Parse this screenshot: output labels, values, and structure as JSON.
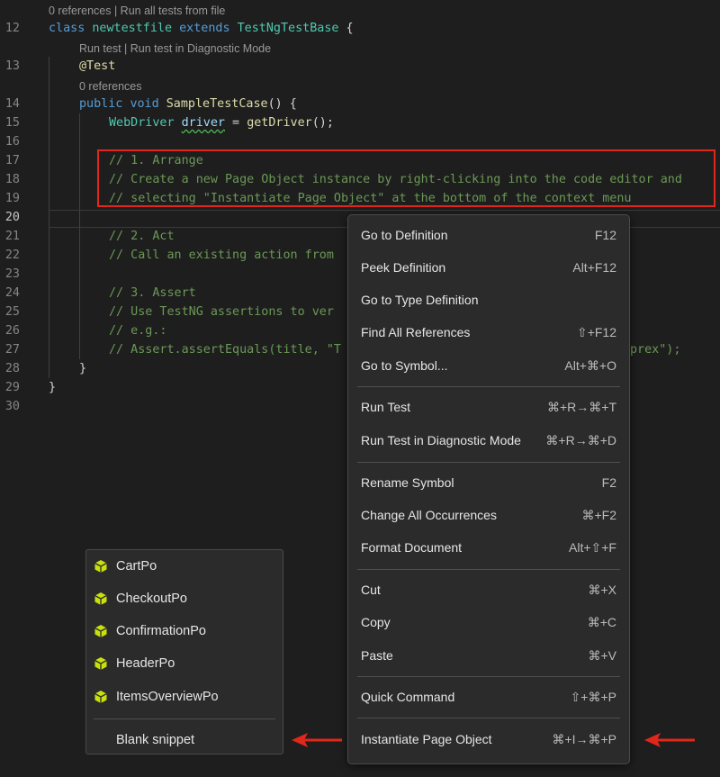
{
  "codelens": {
    "class_refs": "0 references | Run all tests from file",
    "run_test": "Run test | Run test in Diagnostic Mode",
    "method_refs": "0 references"
  },
  "lines": [
    {
      "n": "12"
    },
    {
      "n": "13"
    },
    {
      "n": "14"
    },
    {
      "n": "15"
    },
    {
      "n": "16"
    },
    {
      "n": "17"
    },
    {
      "n": "18"
    },
    {
      "n": "19"
    },
    {
      "n": "20"
    },
    {
      "n": "21"
    },
    {
      "n": "22"
    },
    {
      "n": "23"
    },
    {
      "n": "24"
    },
    {
      "n": "25"
    },
    {
      "n": "26"
    },
    {
      "n": "27"
    },
    {
      "n": "28"
    },
    {
      "n": "29"
    },
    {
      "n": "30"
    }
  ],
  "code": {
    "l12_kw_class": "class",
    "l12_name": "newtestfile",
    "l12_kw_extends": "extends",
    "l12_base": "TestNgTestBase",
    "l12_brace": " {",
    "l13": "@Test",
    "l14_kw_public": "public",
    "l14_kw_void": "void",
    "l14_fn": "SampleTestCase",
    "l14_rest": "() {",
    "l15_type": "WebDriver",
    "l15_var": "driver",
    "l15_eq": " = ",
    "l15_fn": "getDriver",
    "l15_rest": "();",
    "l17": "// 1. Arrange",
    "l18": "// Create a new Page Object instance by right-clicking into the code editor and",
    "l19": "// selecting \"Instantiate Page Object\" at the bottom of the context menu",
    "l21": "// 2. Act",
    "l22": "// Call an existing action from",
    "l24": "// 3. Assert",
    "l25": "// Use TestNG assertions to ver",
    "l26": "// e.g.:",
    "l27": "// Assert.assertEquals(title, \"T",
    "l27_tail": "prex\");",
    "l28": "}",
    "l29": "}"
  },
  "context_menu": {
    "items": [
      {
        "label": "Go to Definition",
        "key": "F12"
      },
      {
        "label": "Peek Definition",
        "key": "Alt+F12"
      },
      {
        "label": "Go to Type Definition",
        "key": ""
      },
      {
        "label": "Find All References",
        "key": "⇧+F12"
      },
      {
        "label": "Go to Symbol...",
        "key": "Alt+⌘+O"
      },
      {
        "label": "Run Test",
        "key": "⌘+R→⌘+T"
      },
      {
        "label": "Run Test in Diagnostic Mode",
        "key": "⌘+R→⌘+D"
      },
      {
        "label": "Rename Symbol",
        "key": "F2"
      },
      {
        "label": "Change All Occurrences",
        "key": "⌘+F2"
      },
      {
        "label": "Format Document",
        "key": "Alt+⇧+F"
      },
      {
        "label": "Cut",
        "key": "⌘+X"
      },
      {
        "label": "Copy",
        "key": "⌘+C"
      },
      {
        "label": "Paste",
        "key": "⌘+V"
      },
      {
        "label": "Quick Command",
        "key": "⇧+⌘+P"
      },
      {
        "label": "Instantiate Page Object",
        "key": "⌘+I→⌘+P"
      }
    ]
  },
  "snippets": {
    "items": [
      {
        "label": "CartPo",
        "icon": "cube-icon"
      },
      {
        "label": "CheckoutPo",
        "icon": "cube-icon"
      },
      {
        "label": "ConfirmationPo",
        "icon": "cube-icon"
      },
      {
        "label": "HeaderPo",
        "icon": "cube-icon"
      },
      {
        "label": "ItemsOverviewPo",
        "icon": "cube-icon"
      },
      {
        "label": "Blank snippet",
        "icon": ""
      }
    ]
  },
  "colors": {
    "highlight": "#e0271b",
    "arrow": "#e0271b",
    "cube_icon": "#c8e00b"
  }
}
